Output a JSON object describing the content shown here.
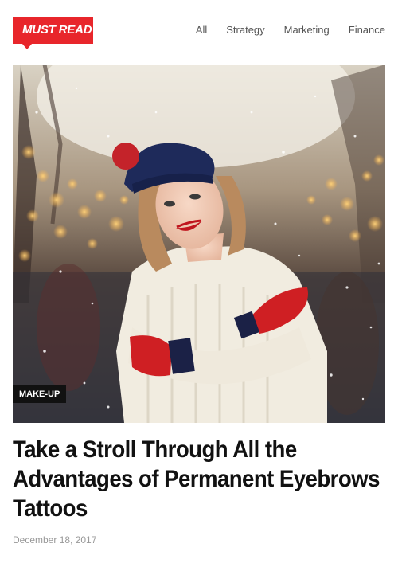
{
  "header": {
    "badge_label": "MUST READ",
    "filters": [
      "All",
      "Strategy",
      "Marketing",
      "Finance"
    ]
  },
  "post": {
    "category": "MAKE-UP",
    "title": "Take a Stroll Through All the Advantages of Permanent Eyebrows Tattoos",
    "date": "December 18, 2017",
    "image_description_icon": "photo-woman-winter"
  },
  "colors": {
    "accent": "#e8262b",
    "category_bg": "#111111",
    "title": "#111111",
    "meta": "#999999"
  }
}
